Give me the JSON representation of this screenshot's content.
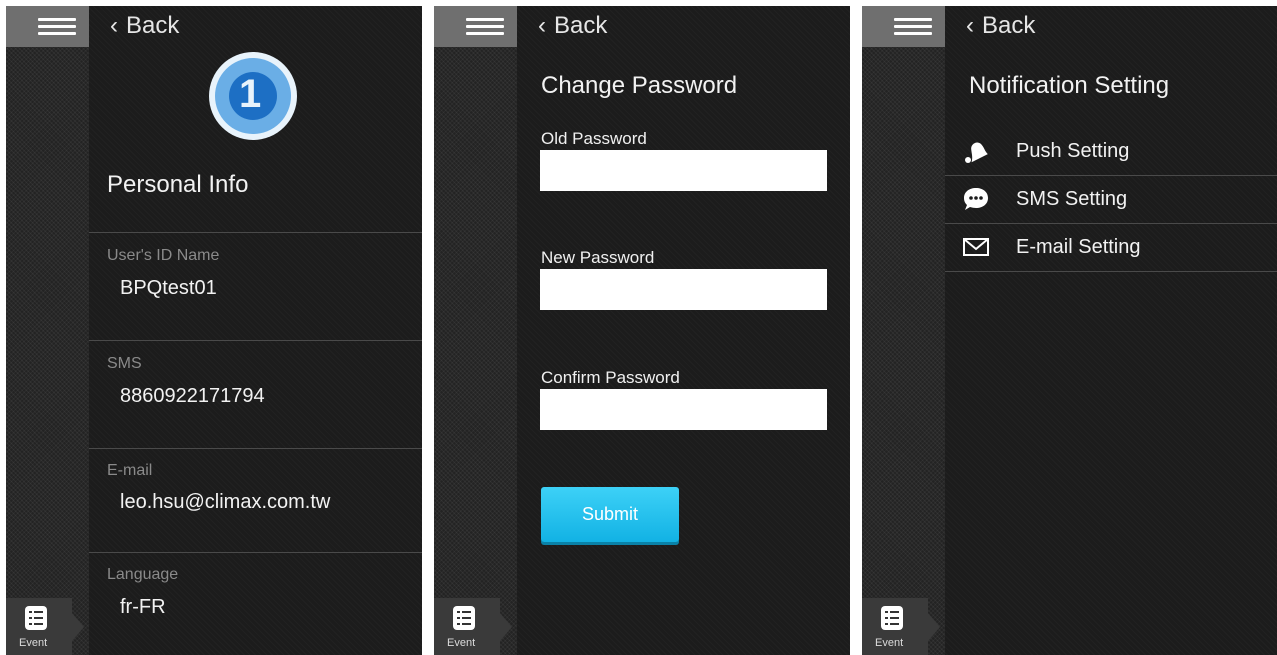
{
  "common": {
    "back_label": "Back",
    "event_label": "Event"
  },
  "personal_info": {
    "title": "Personal Info",
    "fields": [
      {
        "label": "User's ID Name",
        "value": "BPQtest01"
      },
      {
        "label": "SMS",
        "value": "8860922171794"
      },
      {
        "label": "E-mail",
        "value": "leo.hsu@climax.com.tw"
      },
      {
        "label": "Language",
        "value": "fr-FR"
      }
    ]
  },
  "change_password": {
    "title": "Change Password",
    "old_label": "Old Password",
    "old_value": "",
    "new_label": "New Password",
    "new_value": "",
    "confirm_label": "Confirm Password",
    "confirm_value": "",
    "submit_label": "Submit"
  },
  "notification": {
    "title": "Notification Setting",
    "items": [
      {
        "label": "Push Setting",
        "icon": "bell-icon"
      },
      {
        "label": "SMS Setting",
        "icon": "chat-bubble-icon"
      },
      {
        "label": "E-mail Setting",
        "icon": "envelope-icon"
      }
    ]
  },
  "colors": {
    "accent": "#1fbfed",
    "background": "#1c1c1c",
    "rail": "#232323",
    "menu_button": "#6f6f6f"
  }
}
